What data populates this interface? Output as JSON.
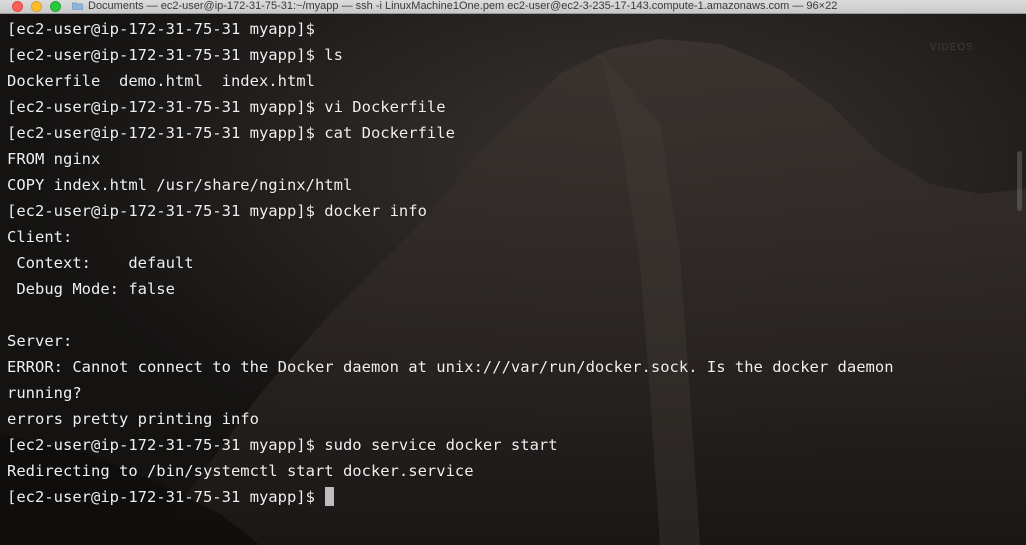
{
  "window": {
    "title": "Documents — ec2-user@ip-172-31-75-31:~/myapp — ssh -i LinuxMachine1One.pem ec2-user@ec2-3-235-17-143.compute-1.amazonaws.com — 96×22",
    "watermark": "VIDEOS",
    "icons": {
      "close": "close-button",
      "minimize": "minimize-button",
      "zoom": "zoom-button",
      "folder": "folder-icon"
    }
  },
  "terminal": {
    "lines": [
      "[ec2-user@ip-172-31-75-31 myapp]$",
      "[ec2-user@ip-172-31-75-31 myapp]$ ls",
      "Dockerfile  demo.html  index.html",
      "[ec2-user@ip-172-31-75-31 myapp]$ vi Dockerfile",
      "[ec2-user@ip-172-31-75-31 myapp]$ cat Dockerfile",
      "FROM nginx",
      "COPY index.html /usr/share/nginx/html",
      "[ec2-user@ip-172-31-75-31 myapp]$ docker info",
      "Client:",
      " Context:    default",
      " Debug Mode: false",
      "",
      "Server:",
      "ERROR: Cannot connect to the Docker daemon at unix:///var/run/docker.sock. Is the docker daemon",
      "running?",
      "errors pretty printing info",
      "[ec2-user@ip-172-31-75-31 myapp]$ sudo service docker start",
      "Redirecting to /bin/systemctl start docker.service"
    ],
    "prompt": "[ec2-user@ip-172-31-75-31 myapp]$ "
  },
  "colors": {
    "text": "#f0f0f0",
    "background": "#151412",
    "cursor": "#bdbdbd"
  }
}
